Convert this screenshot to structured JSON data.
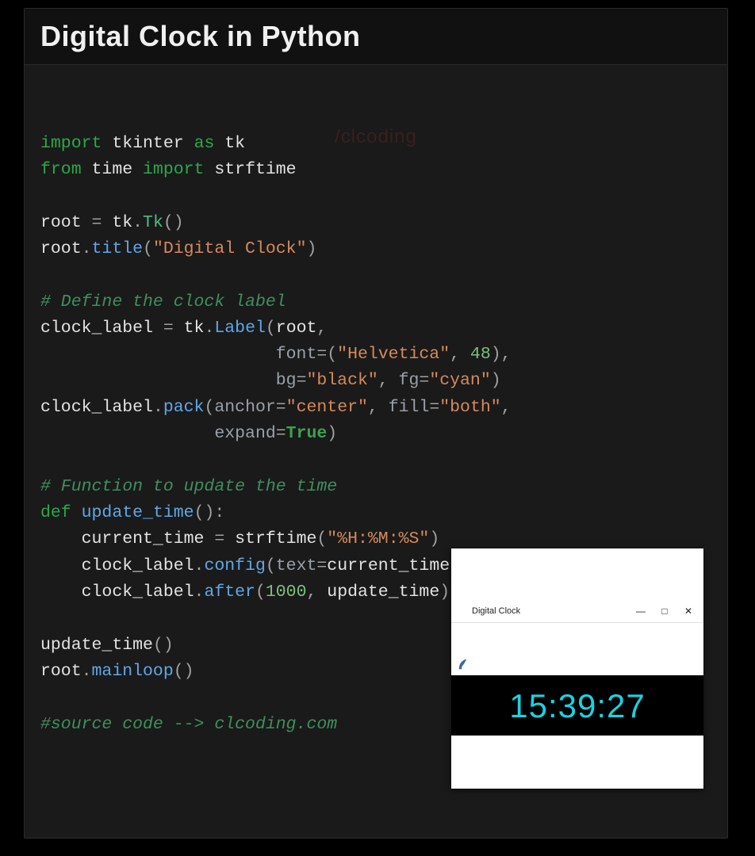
{
  "title": "Digital Clock in Python",
  "watermark": "/clcoding",
  "code": {
    "l1_import": "import",
    "l1_tk": "tkinter",
    "l1_as": "as",
    "l1_alias": "tk",
    "l2_from": "from",
    "l2_time": "time",
    "l2_import": "import",
    "l2_strf": "strftime",
    "l4_root": "root",
    "l4_eq": "=",
    "l4_tk": "tk",
    "l4_dot": ".",
    "l4_Tk": "Tk",
    "l4_paren": "()",
    "l5_root": "root",
    "l5_dot": ".",
    "l5_title": "title",
    "l5_open": "(",
    "l5_str": "\"Digital Clock\"",
    "l5_close": ")",
    "c1": "# Define the clock label",
    "l7_cl": "clock_label",
    "l7_eq": "=",
    "l7_tk": "tk",
    "l7_dot": ".",
    "l7_Label": "Label",
    "l7_open": "(",
    "l7_root": "root",
    "l7_comma": ",",
    "l8_font": "font",
    "l8_eq": "=",
    "l8_p1": "(",
    "l8_helv": "\"Helvetica\"",
    "l8_c": ",",
    "l8_num": "48",
    "l8_p2": ")",
    "l8_comma": ",",
    "l9_bg": "bg",
    "l9_eq": "=",
    "l9_black": "\"black\"",
    "l9_c": ",",
    "l9_fg": "fg",
    "l9_eq2": "=",
    "l9_cyan": "\"cyan\"",
    "l9_close": ")",
    "l10_cl": "clock_label",
    "l10_dot": ".",
    "l10_pack": "pack",
    "l10_open": "(",
    "l10_anchor": "anchor",
    "l10_eq": "=",
    "l10_center": "\"center\"",
    "l10_c": ",",
    "l10_fill": "fill",
    "l10_eq2": "=",
    "l10_both": "\"both\"",
    "l10_c2": ",",
    "l11_expand": "expand",
    "l11_eq": "=",
    "l11_true": "True",
    "l11_close": ")",
    "c2": "# Function to update the time",
    "l13_def": "def",
    "l13_ut": "update_time",
    "l13_rest": "():",
    "l14_ct": "current_time",
    "l14_eq": "=",
    "l14_strf": "strftime",
    "l14_open": "(",
    "l14_fmt": "\"%H:%M:%S\"",
    "l14_close": ")",
    "l15_cl": "clock_label",
    "l15_dot": ".",
    "l15_config": "config",
    "l15_open": "(",
    "l15_text": "text",
    "l15_eq": "=",
    "l15_ct": "current_time",
    "l15_close": ")",
    "l16_cl": "clock_label",
    "l16_dot": ".",
    "l16_after": "after",
    "l16_open": "(",
    "l16_num": "1000",
    "l16_c": ",",
    "l16_ut": "update_time",
    "l16_close": ")",
    "l18_ut": "update_time",
    "l18_paren": "()",
    "l19_root": "root",
    "l19_dot": ".",
    "l19_ml": "mainloop",
    "l19_paren": "()",
    "c3": "#source code --> clcoding.com"
  },
  "clock_window": {
    "title": "Digital Clock",
    "time": "15:39:27",
    "minimize": "—",
    "maximize": "□",
    "close": "✕"
  }
}
